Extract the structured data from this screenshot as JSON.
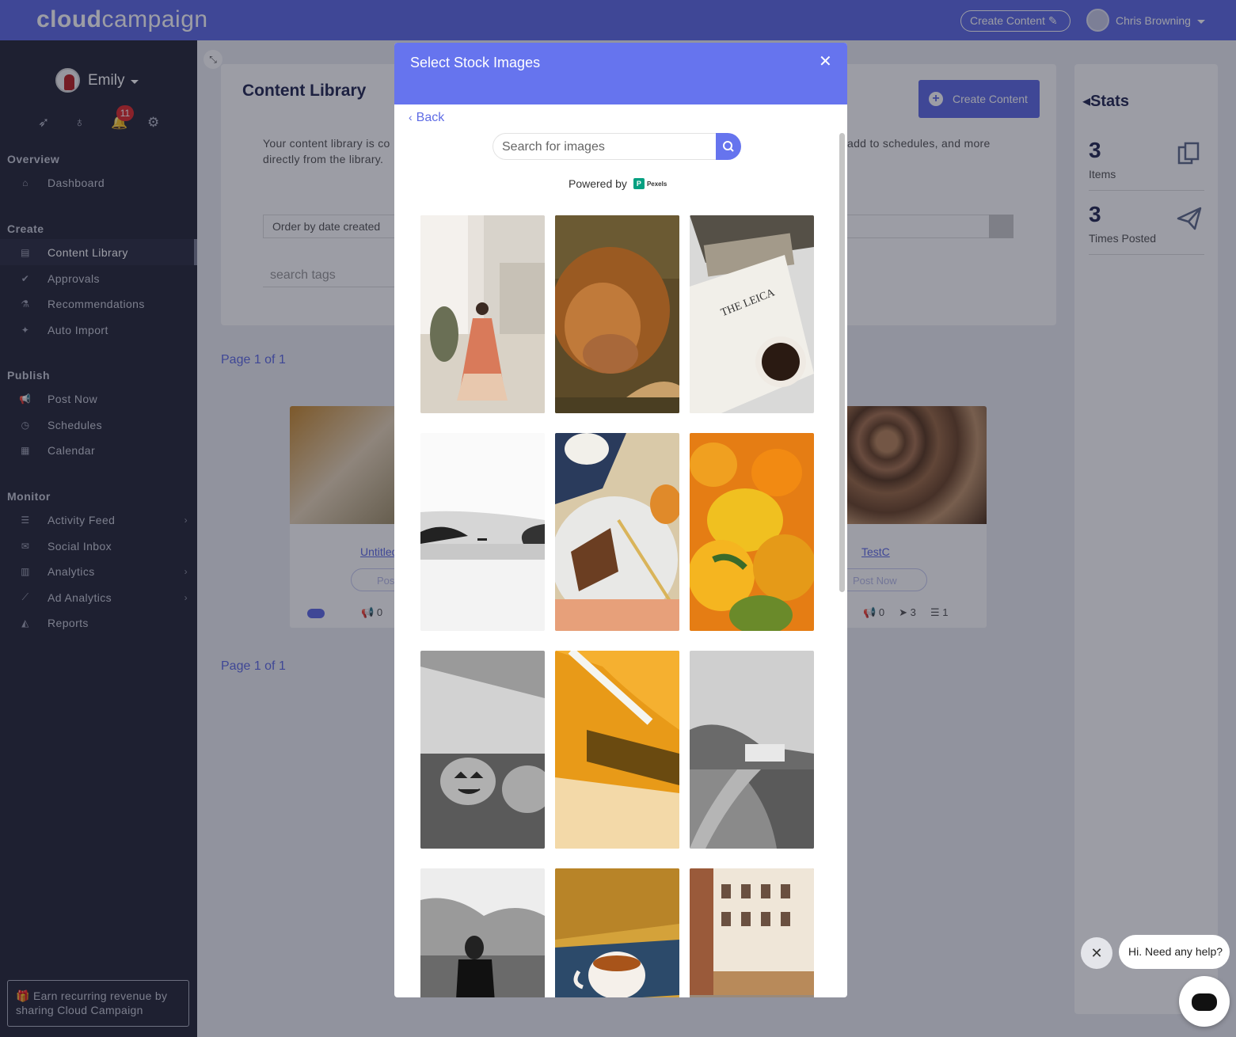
{
  "topbar": {
    "logo_bold": "cloud",
    "logo_light": "campaign",
    "create_label": "Create Content",
    "user_name": "Chris Browning"
  },
  "sidebar": {
    "account_name": "Emily",
    "notification_count": "11",
    "sections": {
      "overview": "Overview",
      "create": "Create",
      "publish": "Publish",
      "monitor": "Monitor"
    },
    "items": {
      "dashboard": "Dashboard",
      "content_library": "Content Library",
      "approvals": "Approvals",
      "recommendations": "Recommendations",
      "auto_import": "Auto Import",
      "post_now": "Post Now",
      "schedules": "Schedules",
      "calendar": "Calendar",
      "activity_feed": "Activity Feed",
      "social_inbox": "Social Inbox",
      "analytics": "Analytics",
      "ad_analytics": "Ad Analytics",
      "reports": "Reports"
    },
    "earn_text": "Earn recurring revenue by sharing Cloud Campaign"
  },
  "library": {
    "title": "Content Library",
    "create_label": "Create Content",
    "desc_left": "Your content library is co",
    "desc_left_2": "directly from the library.",
    "desc_right": "add to schedules, and more",
    "order_by": "Order by date created",
    "tags_placeholder": "search tags",
    "page_label_top": "Page 1 of 1",
    "page_label_bottom": "Page 1 of 1"
  },
  "posts": [
    {
      "title": "Untitled",
      "button": "Pos",
      "scheduled": "0"
    },
    {
      "title": "TestC",
      "button": "Post Now",
      "scheduled": "0",
      "posted": "3",
      "items": "1"
    }
  ],
  "stats": {
    "title": "Stats",
    "items_value": "3",
    "items_label": "Items",
    "posted_value": "3",
    "posted_label": "Times Posted"
  },
  "modal": {
    "title": "Select Stock Images",
    "back_label": "Back",
    "search_placeholder": "Search for images",
    "powered_by": "Powered by",
    "provider": "Pexels"
  },
  "chat": {
    "greeting": "Hi. Need any help?"
  },
  "colors": {
    "accent": "#5f6ce5",
    "modal_header": "#6674ee",
    "sidebar_bg": "#262838"
  }
}
